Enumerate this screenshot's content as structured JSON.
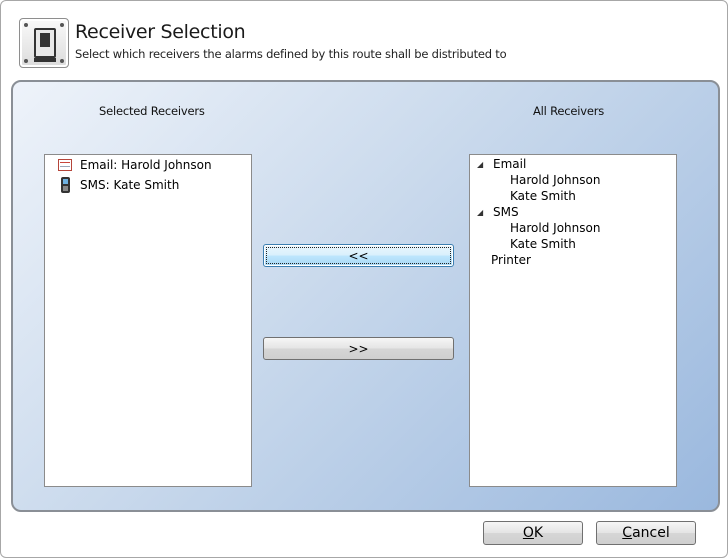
{
  "header": {
    "title": "Receiver Selection",
    "subtitle": "Select which receivers the alarms defined by this route shall be distributed to",
    "icon": "switch-plate-icon"
  },
  "selected": {
    "heading": "Selected Receivers",
    "items": [
      {
        "label": "Email: Harold Johnson",
        "icon": "email-icon"
      },
      {
        "label": "SMS: Kate Smith",
        "icon": "mobile-phone-icon"
      }
    ]
  },
  "all": {
    "heading": "All Receivers",
    "tree": [
      {
        "label": "Email",
        "expanded": true,
        "children": [
          "Harold Johnson",
          "Kate Smith"
        ]
      },
      {
        "label": "SMS",
        "expanded": true,
        "children": [
          "Harold Johnson",
          "Kate Smith"
        ]
      },
      {
        "label": "Printer"
      }
    ]
  },
  "buttons": {
    "add": "<<",
    "remove": ">>",
    "ok_access": "O",
    "ok_rest": "K",
    "cancel_access": "C",
    "cancel_rest": "ancel"
  },
  "colors": {
    "panel_gradient_start": "#eef3fa",
    "panel_gradient_end": "#9ab8de",
    "focus_border": "#3c7fb1"
  }
}
